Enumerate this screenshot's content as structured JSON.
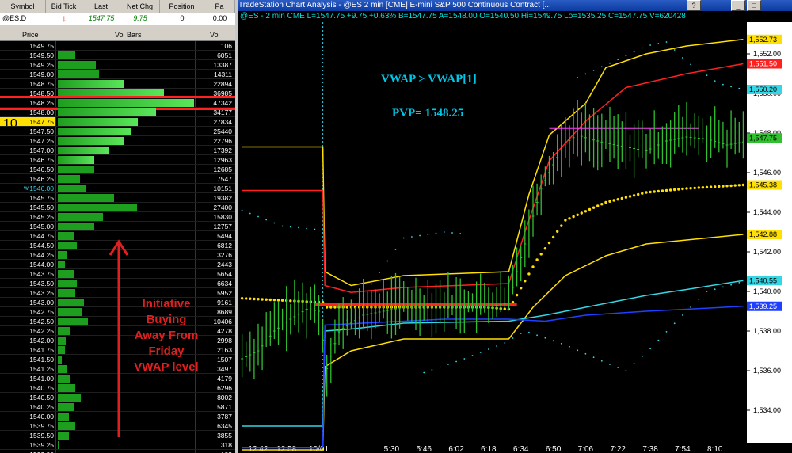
{
  "colors": {
    "bg": "#000000",
    "ladder_bar": "#1e9e1e",
    "ladder_bar_hi": "#5ae65a",
    "current": "#ffe000",
    "vwap": "#ffe000",
    "red": "#ff2020",
    "cyan": "#35d6e6",
    "blue": "#2040ff",
    "magenta": "#ff40ff"
  },
  "quote": {
    "headers": [
      "Symbol",
      "Bid Tick",
      "Last",
      "Net Chg",
      "Position",
      "Pa"
    ],
    "symbol": "@ES.D",
    "tick_icon": "down-arrow-icon",
    "last": "1547.75",
    "net_chg": "9.75",
    "position": "0",
    "pa": "0.00"
  },
  "ladder": {
    "headers": {
      "price": "Price",
      "volbars": "Vol Bars",
      "vol": "Vol"
    },
    "current_marker": "10",
    "low_marker": "w",
    "rows": [
      {
        "price": "1549.75",
        "vol": "106",
        "bar": 0.0
      },
      {
        "price": "1549.50",
        "vol": "6051",
        "bar": 0.13
      },
      {
        "price": "1549.25",
        "vol": "13387",
        "bar": 0.28
      },
      {
        "price": "1549.00",
        "vol": "14311",
        "bar": 0.3
      },
      {
        "price": "1548.75",
        "vol": "22894",
        "bar": 0.48
      },
      {
        "price": "1548.50",
        "vol": "36985",
        "bar": 0.78
      },
      {
        "price": "1548.25",
        "vol": "47342",
        "bar": 1.0
      },
      {
        "price": "1548.00",
        "vol": "34177",
        "bar": 0.72
      },
      {
        "price": "1547.75",
        "vol": "27834",
        "bar": 0.59
      },
      {
        "price": "1547.50",
        "vol": "25440",
        "bar": 0.54
      },
      {
        "price": "1547.25",
        "vol": "22796",
        "bar": 0.48
      },
      {
        "price": "1547.00",
        "vol": "17392",
        "bar": 0.37
      },
      {
        "price": "1546.75",
        "vol": "12963",
        "bar": 0.27
      },
      {
        "price": "1546.50",
        "vol": "12685",
        "bar": 0.27
      },
      {
        "price": "1546.25",
        "vol": "7547",
        "bar": 0.16
      },
      {
        "price": "1546.00",
        "vol": "10151",
        "bar": 0.21
      },
      {
        "price": "1545.75",
        "vol": "19382",
        "bar": 0.41
      },
      {
        "price": "1545.50",
        "vol": "27400",
        "bar": 0.58
      },
      {
        "price": "1545.25",
        "vol": "15830",
        "bar": 0.33
      },
      {
        "price": "1545.00",
        "vol": "12757",
        "bar": 0.27
      },
      {
        "price": "1544.75",
        "vol": "5494",
        "bar": 0.12
      },
      {
        "price": "1544.50",
        "vol": "6812",
        "bar": 0.14
      },
      {
        "price": "1544.25",
        "vol": "3276",
        "bar": 0.07
      },
      {
        "price": "1544.00",
        "vol": "2443",
        "bar": 0.05
      },
      {
        "price": "1543.75",
        "vol": "5654",
        "bar": 0.12
      },
      {
        "price": "1543.50",
        "vol": "6634",
        "bar": 0.14
      },
      {
        "price": "1543.25",
        "vol": "5952",
        "bar": 0.13
      },
      {
        "price": "1543.00",
        "vol": "9161",
        "bar": 0.19
      },
      {
        "price": "1542.75",
        "vol": "8689",
        "bar": 0.18
      },
      {
        "price": "1542.50",
        "vol": "10406",
        "bar": 0.22
      },
      {
        "price": "1542.25",
        "vol": "4278",
        "bar": 0.09
      },
      {
        "price": "1542.00",
        "vol": "2998",
        "bar": 0.06
      },
      {
        "price": "1541.75",
        "vol": "2163",
        "bar": 0.05
      },
      {
        "price": "1541.50",
        "vol": "1507",
        "bar": 0.03
      },
      {
        "price": "1541.25",
        "vol": "3497",
        "bar": 0.07
      },
      {
        "price": "1541.00",
        "vol": "4179",
        "bar": 0.09
      },
      {
        "price": "1540.75",
        "vol": "6296",
        "bar": 0.13
      },
      {
        "price": "1540.50",
        "vol": "8002",
        "bar": 0.17
      },
      {
        "price": "1540.25",
        "vol": "5871",
        "bar": 0.12
      },
      {
        "price": "1540.00",
        "vol": "3787",
        "bar": 0.08
      },
      {
        "price": "1539.75",
        "vol": "6345",
        "bar": 0.13
      },
      {
        "price": "1539.50",
        "vol": "3855",
        "bar": 0.08
      },
      {
        "price": "1539.25",
        "vol": "318",
        "bar": 0.01
      },
      {
        "price": "1539.00",
        "vol": "103",
        "bar": 0.0
      }
    ],
    "current_price": "1547.75",
    "low_price": "1546.00",
    "pvp_price": "1548.25"
  },
  "annotation": {
    "initiative_lines": [
      "Initiative",
      "Buying",
      "Away From",
      "Friday",
      "VWAP level"
    ]
  },
  "window": {
    "title": "TradeStation Chart Analysis - @ES  2 min  [CME] E-mini S&P 500 Continuous Contract [...",
    "info_line": "@ES - 2 min    CME  L=1547.75  +9.75  +0.63%  B=1547.75  A=1548.00  O=1540.50  Hi=1549.75  Lo=1535.25  C=1547.75  V=620428",
    "btn_help": "?",
    "btn_min": "_",
    "btn_max": "□"
  },
  "chart_annotations": {
    "vwap_text": "VWAP > VWAP[1]",
    "pvp_text": "PVP= 1548.25"
  },
  "chart_data": {
    "type": "bar",
    "title": "",
    "xlabel": "",
    "ylabel": "",
    "ylim": [
      1532.4,
      1553.6
    ],
    "y_ticks": [
      1534,
      1536,
      1538,
      1540,
      1542,
      1544,
      1546,
      1548,
      1550,
      1552
    ],
    "y_tick_labels": [
      "1,534.00",
      "1,536.00",
      "1,538.00",
      "1,540.00",
      "1,542.00",
      "1,544.00",
      "1,546.00",
      "1,548.00",
      "1,550.00",
      "1,552.00"
    ],
    "x_tick_labels": [
      "12:42",
      "12:58",
      "10/01",
      "5:30",
      "5:46",
      "6:02",
      "6:18",
      "6:34",
      "6:50",
      "7:06",
      "7:22",
      "7:38",
      "7:54",
      "8:10"
    ],
    "x_tick_index": [
      4,
      11,
      19,
      37,
      45,
      53,
      61,
      69,
      77,
      85,
      93,
      101,
      109,
      117
    ],
    "price_boxes": [
      {
        "label": "1,552.73",
        "value": 1552.73,
        "color": "#ffe000"
      },
      {
        "label": "1,551.50",
        "value": 1551.5,
        "color": "#ff2020"
      },
      {
        "label": "1,550.20",
        "value": 1550.2,
        "color": "#35d6e6"
      },
      {
        "label": "1,547.75",
        "value": 1547.75,
        "color": "#30c030"
      },
      {
        "label": "1,545.38",
        "value": 1545.38,
        "color": "#ffe000"
      },
      {
        "label": "1,542.88",
        "value": 1542.88,
        "color": "#ffe000"
      },
      {
        "label": "1,540.55",
        "value": 1540.55,
        "color": "#35d6e6"
      },
      {
        "label": "1,539.25",
        "value": 1539.25,
        "color": "#2040ff"
      }
    ],
    "bar_count": 125,
    "session_break_index": 20,
    "series": [
      {
        "name": "VWAP",
        "style": "dots",
        "color": "#ffe000",
        "points": [
          [
            0,
            1539.65
          ],
          [
            20,
            1539.45
          ],
          [
            21,
            1539.2
          ],
          [
            60,
            1539.2
          ],
          [
            66,
            1539.1
          ],
          [
            73,
            1541.6
          ],
          [
            80,
            1543.6
          ],
          [
            90,
            1544.5
          ],
          [
            100,
            1545.0
          ],
          [
            110,
            1545.2
          ],
          [
            124,
            1545.38
          ]
        ]
      },
      {
        "name": "Upper band 2",
        "style": "line",
        "color": "#ffe000",
        "points": [
          [
            0,
            1547.3
          ],
          [
            20,
            1547.3
          ],
          [
            20.5,
            1541.0
          ],
          [
            27,
            1540.3
          ],
          [
            40,
            1540.8
          ],
          [
            66,
            1541.0
          ],
          [
            71,
            1544.9
          ],
          [
            76,
            1547.9
          ],
          [
            85,
            1549.5
          ],
          [
            90,
            1551.3
          ],
          [
            100,
            1552.0
          ],
          [
            110,
            1552.4
          ],
          [
            124,
            1552.73
          ]
        ]
      },
      {
        "name": "Upper band 1",
        "style": "line",
        "color": "#ff2020",
        "points": [
          [
            0,
            1545.1
          ],
          [
            20,
            1545.1
          ],
          [
            20.5,
            1540.3
          ],
          [
            27,
            1539.95
          ],
          [
            40,
            1540.2
          ],
          [
            66,
            1540.4
          ],
          [
            70,
            1543.0
          ],
          [
            76,
            1546.6
          ],
          [
            85,
            1548.6
          ],
          [
            95,
            1550.3
          ],
          [
            110,
            1551.0
          ],
          [
            124,
            1551.5
          ]
        ]
      },
      {
        "name": "Lower band 2",
        "style": "line",
        "color": "#ffe000",
        "points": [
          [
            0,
            1532.0
          ],
          [
            20,
            1532.0
          ],
          [
            20.5,
            1536.2
          ],
          [
            27,
            1537.0
          ],
          [
            40,
            1537.6
          ],
          [
            66,
            1537.6
          ],
          [
            72,
            1539.2
          ],
          [
            80,
            1540.8
          ],
          [
            90,
            1541.8
          ],
          [
            100,
            1542.4
          ],
          [
            110,
            1542.6
          ],
          [
            124,
            1542.88
          ]
        ]
      },
      {
        "name": "Lower band 1",
        "style": "line",
        "color": "#35d6e6",
        "points": [
          [
            0,
            1533.2
          ],
          [
            20,
            1533.2
          ],
          [
            20.5,
            1538.0
          ],
          [
            27,
            1538.1
          ],
          [
            40,
            1538.4
          ],
          [
            66,
            1538.5
          ],
          [
            75,
            1538.8
          ],
          [
            85,
            1539.2
          ],
          [
            100,
            1539.8
          ],
          [
            110,
            1540.1
          ],
          [
            124,
            1540.55
          ]
        ]
      },
      {
        "name": "Lower band 3",
        "style": "line",
        "color": "#2040ff",
        "points": [
          [
            0,
            1532.1
          ],
          [
            20,
            1532.1
          ],
          [
            20.5,
            1538.3
          ],
          [
            30,
            1538.4
          ],
          [
            50,
            1538.6
          ],
          [
            66,
            1538.6
          ],
          [
            75,
            1538.5
          ],
          [
            85,
            1538.8
          ],
          [
            100,
            1539.0
          ],
          [
            110,
            1539.1
          ],
          [
            124,
            1539.25
          ]
        ]
      },
      {
        "name": "Upper dotted",
        "style": "dotted",
        "color": "#35d6e6",
        "points": [
          [
            0,
            1544.1
          ],
          [
            10,
            1543.3
          ],
          [
            20,
            1543.1
          ],
          [
            21,
            1537.0
          ],
          [
            30,
            1539.8
          ],
          [
            40,
            1542.7
          ],
          [
            50,
            1543.0
          ],
          [
            55,
            1542.9
          ]
        ]
      },
      {
        "name": "Upper dotted 2",
        "style": "dotted",
        "color": "#35d6e6",
        "points": [
          [
            83,
            1550.8
          ],
          [
            95,
            1551.9
          ],
          [
            100,
            1552.4
          ],
          [
            105,
            1552.6
          ],
          [
            110,
            1551.6
          ],
          [
            118,
            1550.5
          ],
          [
            124,
            1550.2
          ]
        ]
      },
      {
        "name": "Lower dotted",
        "style": "dotted",
        "color": "#35d6e6",
        "points": [
          [
            45,
            1535.9
          ],
          [
            55,
            1536.6
          ],
          [
            65,
            1537.4
          ],
          [
            70,
            1538.0
          ],
          [
            80,
            1537.3
          ],
          [
            90,
            1536.4
          ],
          [
            95,
            1536.0
          ],
          [
            100,
            1536.9
          ],
          [
            108,
            1538.6
          ],
          [
            115,
            1540.0
          ],
          [
            124,
            1540.5
          ]
        ]
      },
      {
        "name": "Horizontal red level",
        "style": "hline",
        "color": "#ff2020",
        "width": 4,
        "points": [
          [
            18,
            1539.35
          ],
          [
            68,
            1539.35
          ]
        ]
      },
      {
        "name": "PVP line",
        "style": "hline",
        "color": "#ff40ff",
        "width": 2,
        "points": [
          [
            76,
            1548.25
          ],
          [
            113,
            1548.25
          ]
        ]
      },
      {
        "name": "Close",
        "style": "ohlc",
        "color": "#30c030",
        "points": [
          [
            0,
            1536.8
          ],
          [
            4,
            1537.2
          ],
          [
            8,
            1538.2
          ],
          [
            12,
            1538.8
          ],
          [
            16,
            1539.3
          ],
          [
            19,
            1539.2
          ],
          [
            21,
            1536.3
          ],
          [
            24,
            1538.2
          ],
          [
            30,
            1539.0
          ],
          [
            40,
            1539.4
          ],
          [
            50,
            1539.4
          ],
          [
            60,
            1539.4
          ],
          [
            66,
            1539.6
          ],
          [
            68,
            1541.2
          ],
          [
            71,
            1543.3
          ],
          [
            74,
            1545.4
          ],
          [
            77,
            1546.6
          ],
          [
            80,
            1547.7
          ],
          [
            83,
            1548.1
          ],
          [
            86,
            1547.9
          ],
          [
            90,
            1547.7
          ],
          [
            95,
            1547.5
          ],
          [
            100,
            1547.3
          ],
          [
            105,
            1547.8
          ],
          [
            110,
            1548.0
          ],
          [
            115,
            1547.9
          ],
          [
            120,
            1547.6
          ],
          [
            124,
            1547.75
          ]
        ]
      }
    ]
  }
}
